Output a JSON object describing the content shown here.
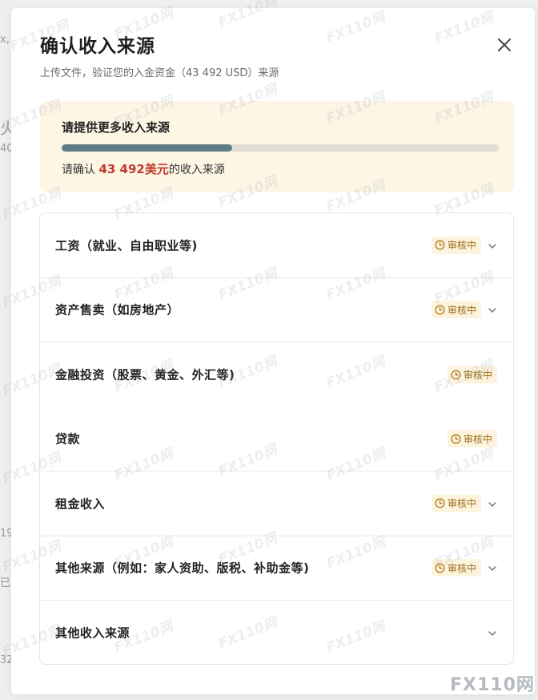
{
  "background": {
    "fragments": [
      "x,",
      "火",
      "40",
      "19",
      "已",
      "32"
    ]
  },
  "dialog": {
    "title": "确认收入来源",
    "subtitle": "上传文件，验证您的入金资金（43 492 USD）来源",
    "close_icon": "close-icon"
  },
  "notice": {
    "title": "请提供更多收入来源",
    "progress": 0.39,
    "line_prefix": "请确认 ",
    "amount": "43 492美元",
    "line_suffix": "的收入来源",
    "amount_color": "#c23a2f"
  },
  "sources": [
    {
      "label": "工资（就业、自由职业等)",
      "status": "审核中",
      "expandable": true
    },
    {
      "label": "资产售卖（如房地产）",
      "status": "审核中",
      "expandable": true
    },
    {
      "label": "金融投资（股票、黄金、外汇等)",
      "status": "审核中",
      "expandable": false
    },
    {
      "label": "贷款",
      "status": "审核中",
      "expandable": false
    },
    {
      "label": "租金收入",
      "status": "审核中",
      "expandable": true
    },
    {
      "label": "其他来源（例如：家人资助、版税、补助金等)",
      "status": "审核中",
      "expandable": true
    },
    {
      "label": "其他收入来源",
      "status": "",
      "expandable": true
    }
  ],
  "watermark": "FX110网",
  "logo": "FX110网",
  "colors": {
    "progress_fill": "#5f7c86",
    "badge_bg": "#fdf4df",
    "badge_text": "#9a6a12",
    "notice_bg": "#fdf6e4"
  }
}
